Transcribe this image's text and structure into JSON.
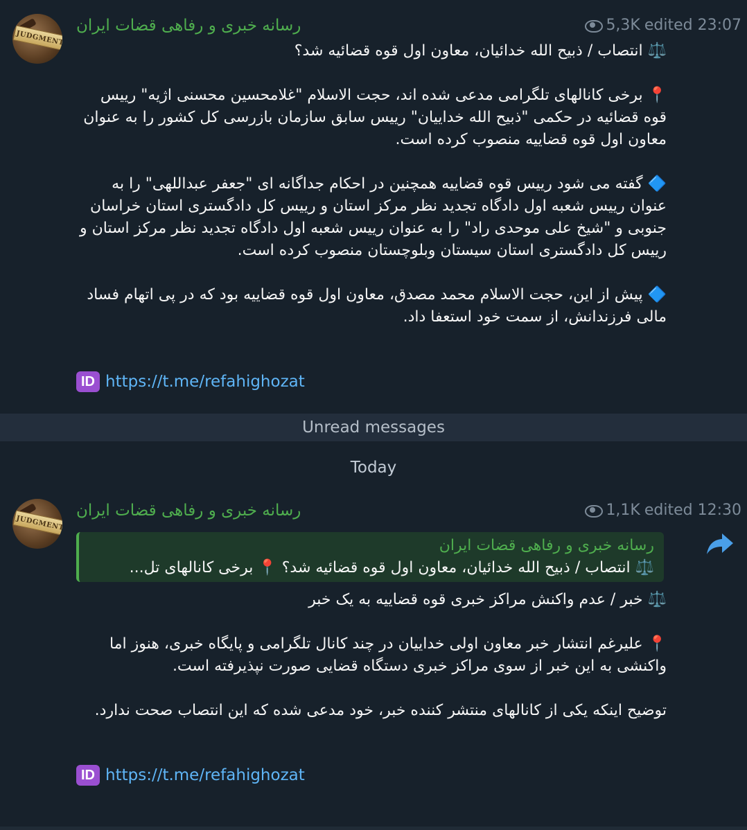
{
  "messages": [
    {
      "sender": "رسانه خبری و رفاهی قضات ایران",
      "avatar_text": "JUDGMENT",
      "views": "5,3K",
      "edited_time": "edited 23:07",
      "paragraphs": [
        "⚖️ انتصاب / ذبیح الله خدائیان، معاون اول قوه قضائیه شد؟",
        "📍 برخی کانالهای تلگرامی مدعی شده اند، حجت الاسلام \"غلامحسین محسنی اژیه\" رییس قوه قضائیه در حکمی \"ذبیح الله خداییان\" رییس سابق سازمان بازرسی کل کشور را به عنوان معاون اول قوه قضاییه منصوب کرده است.",
        "🔷 گفته می شود رییس قوه قضاییه همچنین در احکام جداگانه ای \"جعفر عبداللهی\" را به عنوان رییس شعبه اول دادگاه تجدید نظر مرکز استان و رییس کل دادگستری استان خراسان جنوبی و \"شیخ علی موحدی راد\" را به عنوان رییس شعبه اول دادگاه تجدید نظر مرکز استان و رییس کل دادگستری استان سیستان وبلوچستان منصوب کرده است.",
        "🔷 پیش از این، حجت الاسلام محمد مصدق، معاون اول قوه قضاییه بود که در پی اتهام فساد مالی فرزندانش، از سمت خود استعفا داد."
      ],
      "id_badge": "ID",
      "link": "https://t.me/refahighozat"
    },
    {
      "sender": "رسانه خبری و رفاهی قضات ایران",
      "avatar_text": "JUDGMENT",
      "views": "1,1K",
      "edited_time": "edited 12:30",
      "reply_name": "رسانه خبری و رفاهی قضات ایران",
      "reply_text": "⚖️ انتصاب / ذبیح الله خدائیان، معاون اول قوه قضائیه شد؟ 📍 برخی کانالهای تل...",
      "paragraphs": [
        "⚖️ خبر / عدم واکنش مراکز خبری قوه قضاییه به یک خبر",
        "📍 علیرغم انتشار خبر معاون اولی خداییان در چند کانال تلگرامی و پایگاه خبری، هنوز اما واکنشی به این خبر از سوی مراکز خبری دستگاه قضایی صورت نپذیرفته است.",
        "توضیح اینکه یکی از کانالهای منتشر کننده خبر، خود مدعی شده که این انتصاب صحت ندارد."
      ],
      "id_badge": "ID",
      "link": "https://t.me/refahighozat"
    }
  ],
  "unread_label": "Unread messages",
  "date_label": "Today",
  "colors": {
    "background": "#17212b",
    "sender": "#4fae4e",
    "link": "#5fb5f6",
    "meta": "#7d8b99",
    "unread_bar": "#232e3c"
  },
  "icons": {
    "views": "eye-icon",
    "forward": "forward-arrow-icon",
    "id_badge": "id-badge-icon"
  }
}
